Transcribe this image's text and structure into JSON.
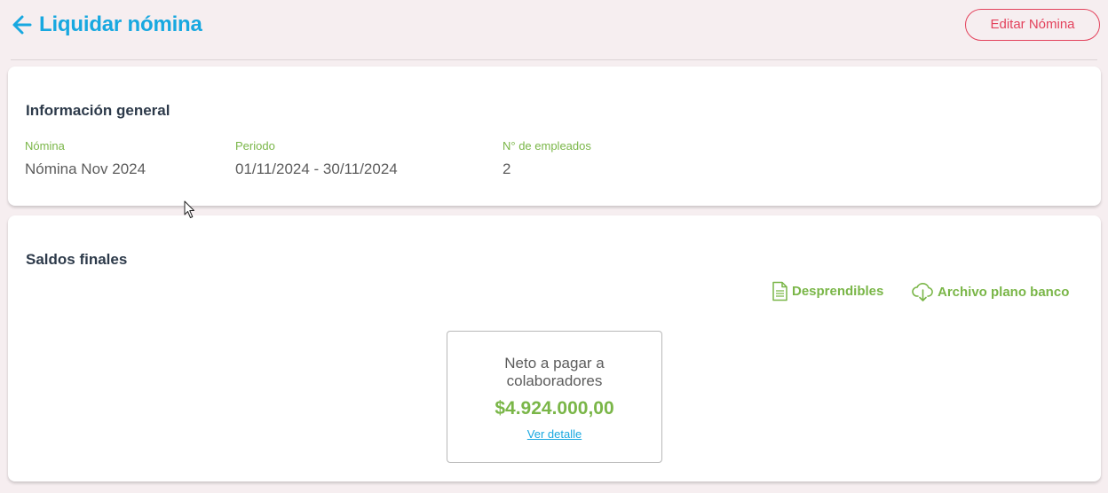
{
  "header": {
    "title": "Liquidar nómina",
    "edit_button": "Editar Nómina"
  },
  "info": {
    "title": "Información general",
    "fields": [
      {
        "label": "Nómina",
        "value": "Nómina Nov 2024"
      },
      {
        "label": "Periodo",
        "value": "01/11/2024 - 30/11/2024"
      },
      {
        "label": "N° de empleados",
        "value": "2"
      }
    ]
  },
  "saldos": {
    "title": "Saldos finales",
    "actions": {
      "desprendibles": "Desprendibles",
      "archivo_banco": "Archivo plano banco"
    },
    "summary": {
      "label": "Neto a pagar a colaboradores",
      "amount": "$4.924.000,00",
      "detail_link": "Ver detalle"
    }
  },
  "colors": {
    "primary_blue": "#18a8e0",
    "accent_red": "#e3425c",
    "accent_green": "#7ab648",
    "background": "#f6eef0"
  }
}
